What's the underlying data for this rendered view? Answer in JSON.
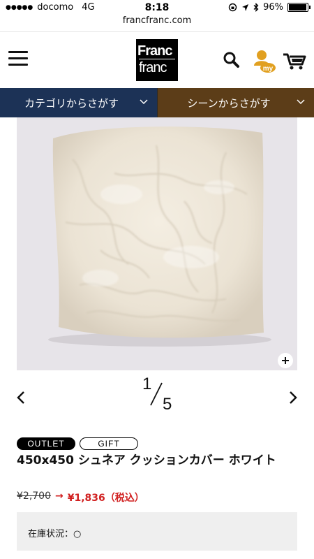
{
  "status_bar": {
    "carrier": "docomo",
    "network": "4G",
    "time": "8:18",
    "battery": "96%",
    "battery_level": 0.96
  },
  "browser": {
    "url": "francfranc.com"
  },
  "header": {
    "logo_line1": "Franc",
    "logo_line2": "franc",
    "my_label": "my"
  },
  "nav": {
    "category": "カテゴリからさがす",
    "scene": "シーンからさがす"
  },
  "gallery": {
    "current": "1",
    "total": "5"
  },
  "product": {
    "tags": [
      "OUTLET",
      "GIFT"
    ],
    "title": "450x450 シュネア クッションカバー ホワイト",
    "old_price": "¥2,700",
    "arrow": "→",
    "new_price": "¥1,836（税込）",
    "stock": "在庫状況：○"
  },
  "icons": {
    "menu": "hamburger-icon",
    "search": "search-icon",
    "mypage": "user-icon",
    "cart": "cart-icon",
    "zoom": "plus-icon",
    "prev": "chevron-left-icon",
    "next": "chevron-right-icon"
  },
  "colors": {
    "nav_category_bg": "#1c3256",
    "nav_scene_bg": "#5c3d18",
    "price_sale": "#d12020",
    "my_icon": "#e1a020"
  }
}
